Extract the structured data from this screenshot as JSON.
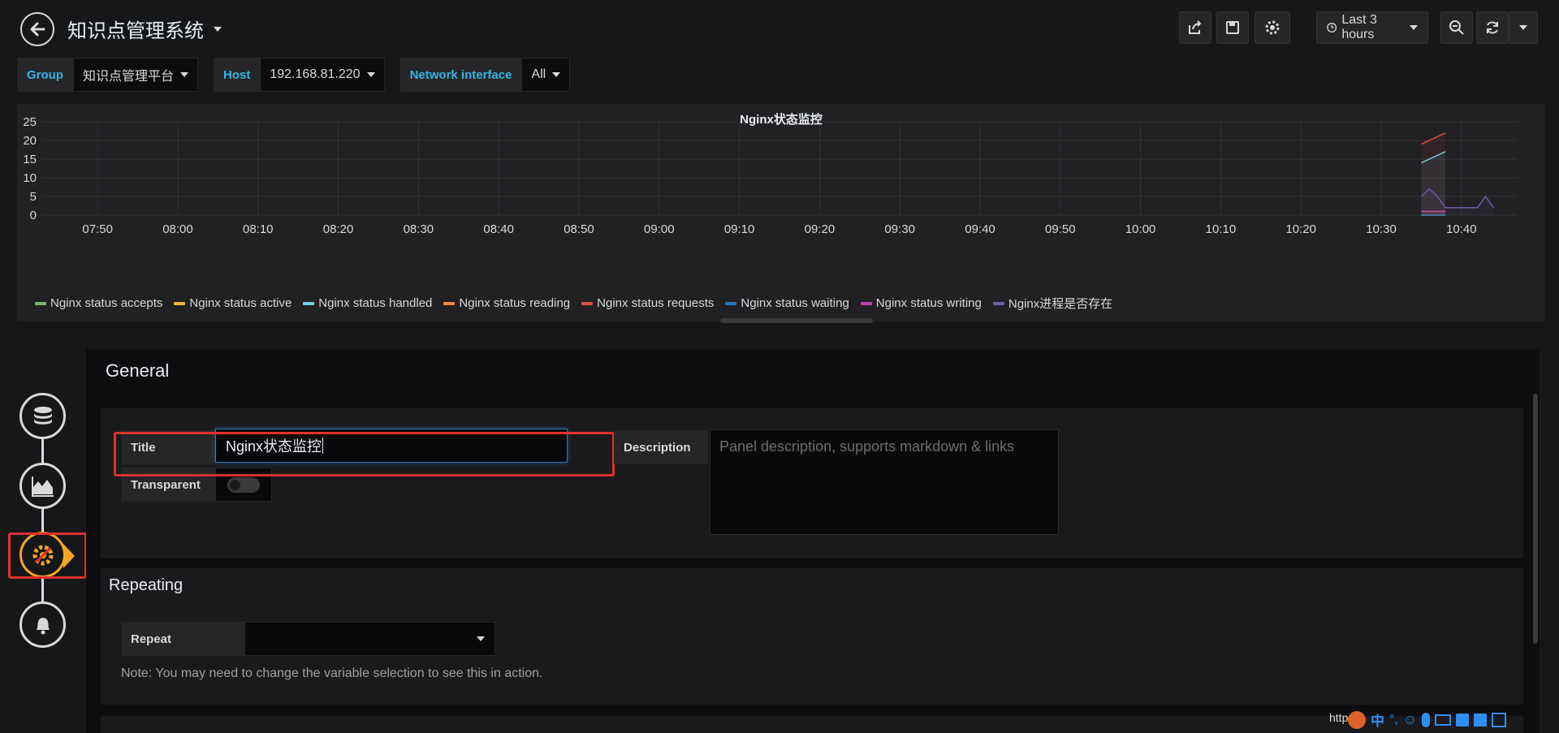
{
  "header": {
    "dashboard_title": "知识点管理系统",
    "time_range": "Last 3 hours"
  },
  "variables": [
    {
      "label": "Group",
      "value": "知识点管理平台"
    },
    {
      "label": "Host",
      "value": "192.168.81.220"
    },
    {
      "label": "Network interface",
      "value": "All"
    }
  ],
  "panel": {
    "title": "Nginx状态监控"
  },
  "chart_data": {
    "type": "line",
    "title": "Nginx状态监控",
    "xlabel": "",
    "ylabel": "",
    "ylim": [
      0,
      25
    ],
    "y_ticks": [
      "0",
      "5",
      "10",
      "15",
      "20",
      "25"
    ],
    "x_ticks": [
      "07:50",
      "08:00",
      "08:10",
      "08:20",
      "08:30",
      "08:40",
      "08:50",
      "09:00",
      "09:10",
      "09:20",
      "09:30",
      "09:40",
      "09:50",
      "10:00",
      "10:10",
      "10:20",
      "10:30",
      "10:40"
    ],
    "grid": true,
    "legend_position": "bottom-left",
    "series": [
      {
        "name": "Nginx status accepts",
        "color": "#7eb26d",
        "points": [
          [
            "10:35",
            0
          ],
          [
            "10:38",
            0
          ]
        ]
      },
      {
        "name": "Nginx status active",
        "color": "#eab839",
        "points": [
          [
            "10:35",
            1
          ],
          [
            "10:38",
            1
          ]
        ]
      },
      {
        "name": "Nginx status handled",
        "color": "#6ed0e0",
        "points": [
          [
            "10:35",
            14
          ],
          [
            "10:38",
            17
          ]
        ]
      },
      {
        "name": "Nginx status reading",
        "color": "#ef843c",
        "points": [
          [
            "10:35",
            0
          ],
          [
            "10:38",
            0
          ]
        ]
      },
      {
        "name": "Nginx status requests",
        "color": "#e24d42",
        "points": [
          [
            "10:35",
            19
          ],
          [
            "10:38",
            22
          ]
        ]
      },
      {
        "name": "Nginx status waiting",
        "color": "#1f78c1",
        "points": [
          [
            "10:35",
            0
          ],
          [
            "10:38",
            0
          ]
        ]
      },
      {
        "name": "Nginx status writing",
        "color": "#ba43a9",
        "points": [
          [
            "10:35",
            1
          ],
          [
            "10:38",
            1
          ]
        ]
      },
      {
        "name": "Nginx进程是否存在",
        "color": "#705da0",
        "points": [
          [
            "10:35",
            5
          ],
          [
            "10:36",
            7
          ],
          [
            "10:37",
            5
          ],
          [
            "10:38",
            2
          ],
          [
            "10:40",
            2
          ],
          [
            "10:42",
            2
          ],
          [
            "10:43",
            5
          ],
          [
            "10:44",
            2
          ]
        ]
      }
    ]
  },
  "editor": {
    "section_general": "General",
    "title_label": "Title",
    "title_value": "Nginx状态监控",
    "description_label": "Description",
    "description_placeholder": "Panel description, supports markdown & links",
    "transparent_label": "Transparent",
    "transparent_on": false,
    "section_repeating": "Repeating",
    "repeat_label": "Repeat",
    "repeat_value": "",
    "note": "Note: You may need to change the variable selection to see this in action."
  },
  "wizard": {
    "steps": [
      "queries",
      "visualization",
      "general",
      "alert"
    ],
    "active": "general",
    "accent_color": "#f5a623"
  },
  "tray": {
    "url_fragment": "https",
    "ime_label": "中"
  }
}
